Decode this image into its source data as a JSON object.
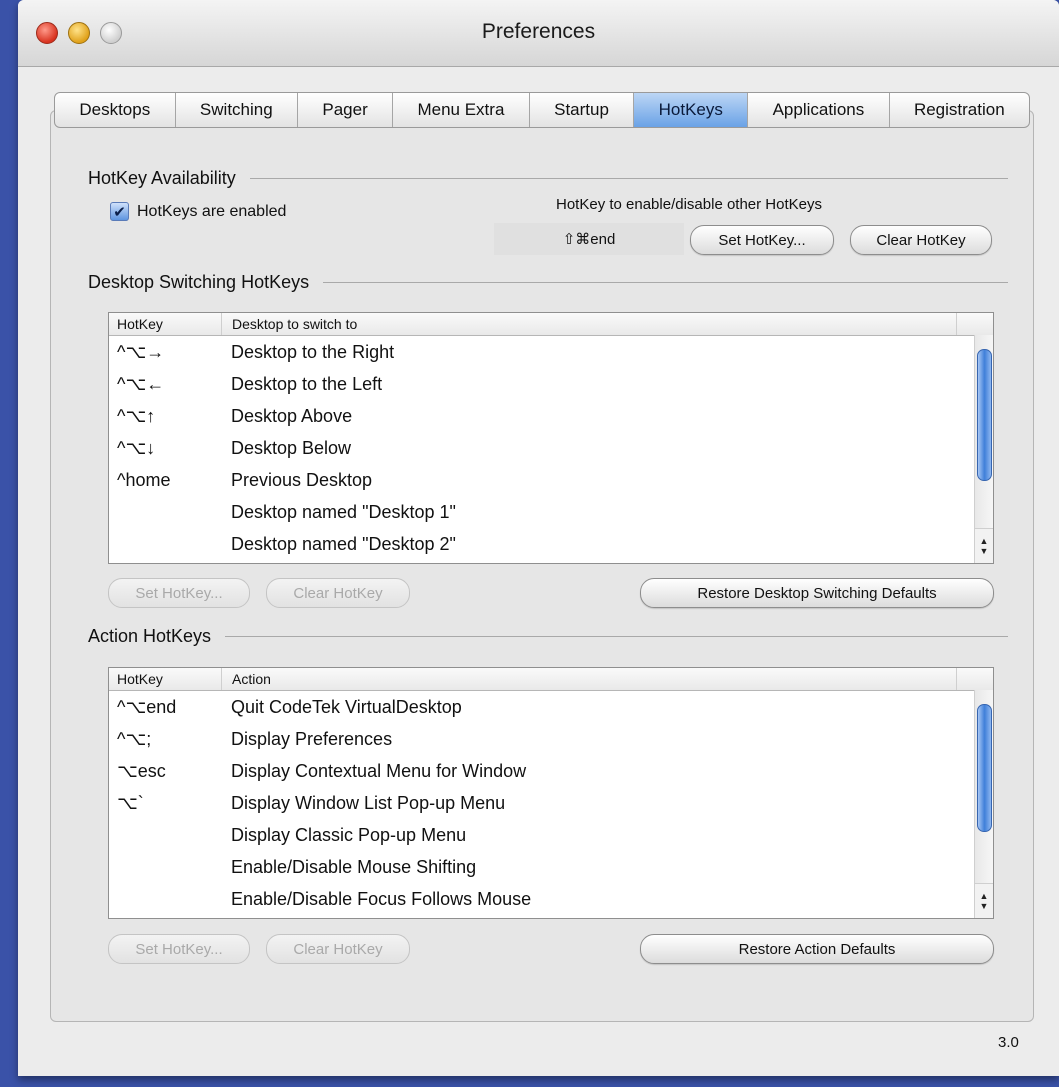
{
  "window": {
    "title": "Preferences",
    "version": "3.0"
  },
  "tabs": [
    {
      "label": "Desktops",
      "active": false
    },
    {
      "label": "Switching",
      "active": false
    },
    {
      "label": "Pager",
      "active": false
    },
    {
      "label": "Menu Extra",
      "active": false
    },
    {
      "label": "Startup",
      "active": false
    },
    {
      "label": "HotKeys",
      "active": true
    },
    {
      "label": "Applications",
      "active": false
    },
    {
      "label": "Registration",
      "active": false
    }
  ],
  "availability": {
    "heading": "HotKey Availability",
    "checkbox_label": "HotKeys are enabled",
    "checked": true,
    "toggle_label": "HotKey to enable/disable other HotKeys",
    "toggle_value": "⇧⌘end",
    "set_label": "Set HotKey...",
    "clear_label": "Clear HotKey"
  },
  "switching": {
    "heading": "Desktop Switching HotKeys",
    "col_hotkey": "HotKey",
    "col_action": "Desktop to switch to",
    "rows": [
      {
        "hotkey": "^⌥→",
        "action": "Desktop to the Right"
      },
      {
        "hotkey": "^⌥←",
        "action": "Desktop to the Left"
      },
      {
        "hotkey": "^⌥↑",
        "action": "Desktop Above"
      },
      {
        "hotkey": "^⌥↓",
        "action": "Desktop Below"
      },
      {
        "hotkey": "^home",
        "action": "Previous Desktop"
      },
      {
        "hotkey": "",
        "action": "Desktop named \"Desktop 1\""
      },
      {
        "hotkey": "",
        "action": "Desktop named \"Desktop 2\""
      }
    ],
    "set_label": "Set HotKey...",
    "clear_label": "Clear HotKey",
    "restore_label": "Restore Desktop Switching Defaults"
  },
  "actions": {
    "heading": "Action HotKeys",
    "col_hotkey": "HotKey",
    "col_action": "Action",
    "rows": [
      {
        "hotkey": "^⌥end",
        "action": "Quit CodeTek VirtualDesktop"
      },
      {
        "hotkey": "^⌥;",
        "action": "Display Preferences"
      },
      {
        "hotkey": "⌥esc",
        "action": "Display Contextual Menu for Window"
      },
      {
        "hotkey": "⌥`",
        "action": "Display Window List Pop-up Menu"
      },
      {
        "hotkey": "",
        "action": "Display Classic Pop-up Menu"
      },
      {
        "hotkey": "",
        "action": "Enable/Disable Mouse Shifting"
      },
      {
        "hotkey": "",
        "action": "Enable/Disable Focus Follows Mouse"
      }
    ],
    "set_label": "Set HotKey...",
    "clear_label": "Clear HotKey",
    "restore_label": "Restore Action Defaults"
  }
}
